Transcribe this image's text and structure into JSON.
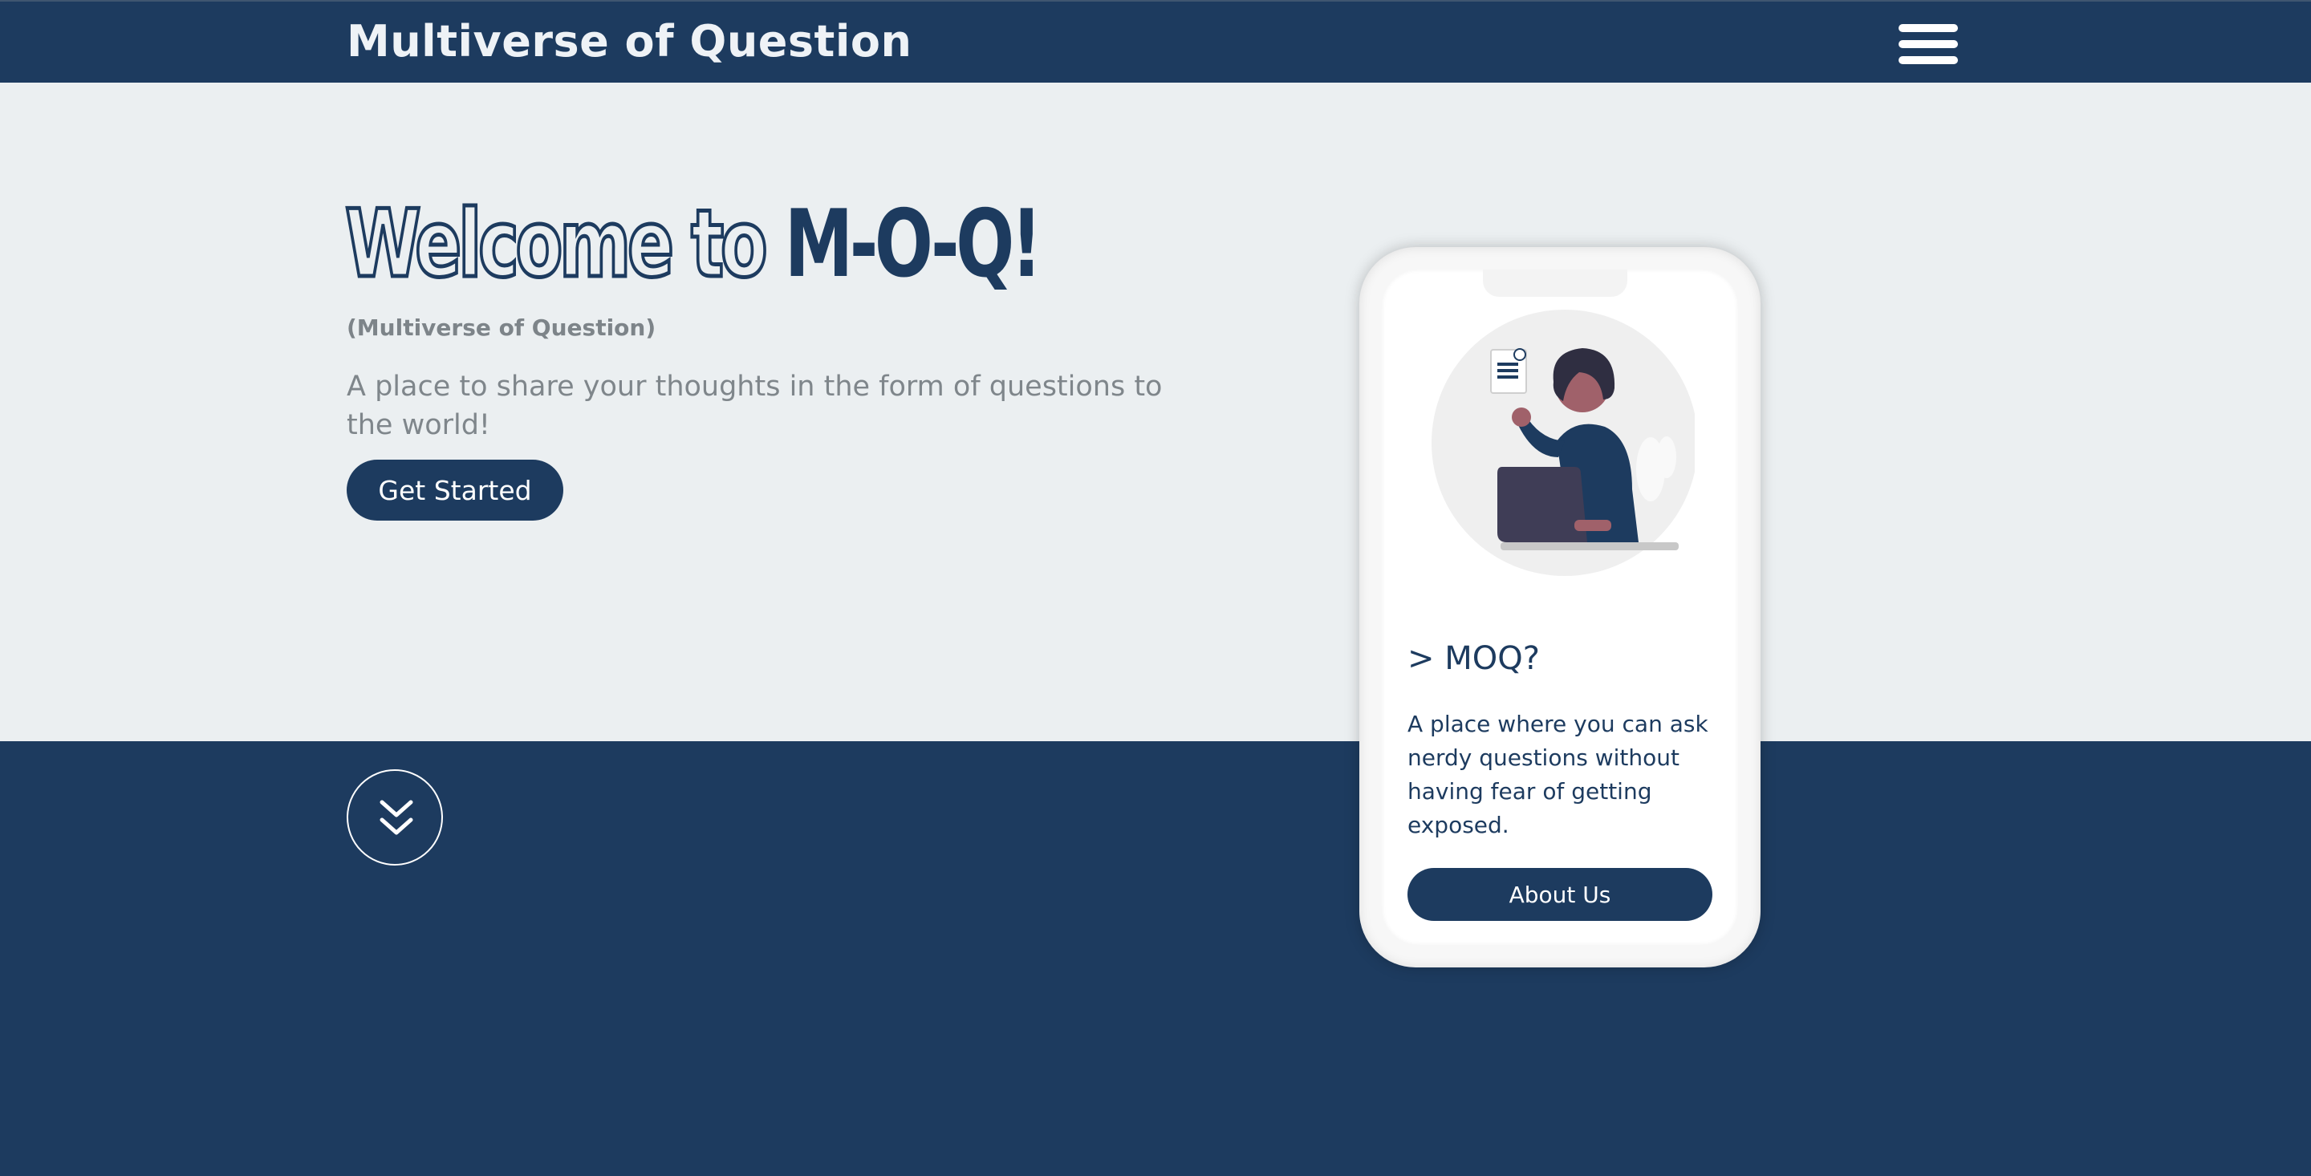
{
  "header": {
    "brand": "Multiverse of Question",
    "menu_icon": "hamburger-menu-icon"
  },
  "hero": {
    "welcome_outline": "Welcome to",
    "welcome_solid": "M-O-Q!",
    "subtitle": "(Multiverse of Question)",
    "tagline": "A place to share your thoughts in the form of questions to the world!",
    "cta_label": "Get Started",
    "scroll_icon": "double-chevron-down-icon"
  },
  "phone_card": {
    "title": "> MOQ?",
    "description": "A place where you can ask nerdy questions without having fear of getting exposed.",
    "button_label": "About Us",
    "illustration": "woman-with-laptop-and-document-illustration"
  },
  "colors": {
    "primary": "#1d3b5f",
    "hero_background": "#ebeff1",
    "muted_text": "#7f868b",
    "white": "#ffffff"
  }
}
